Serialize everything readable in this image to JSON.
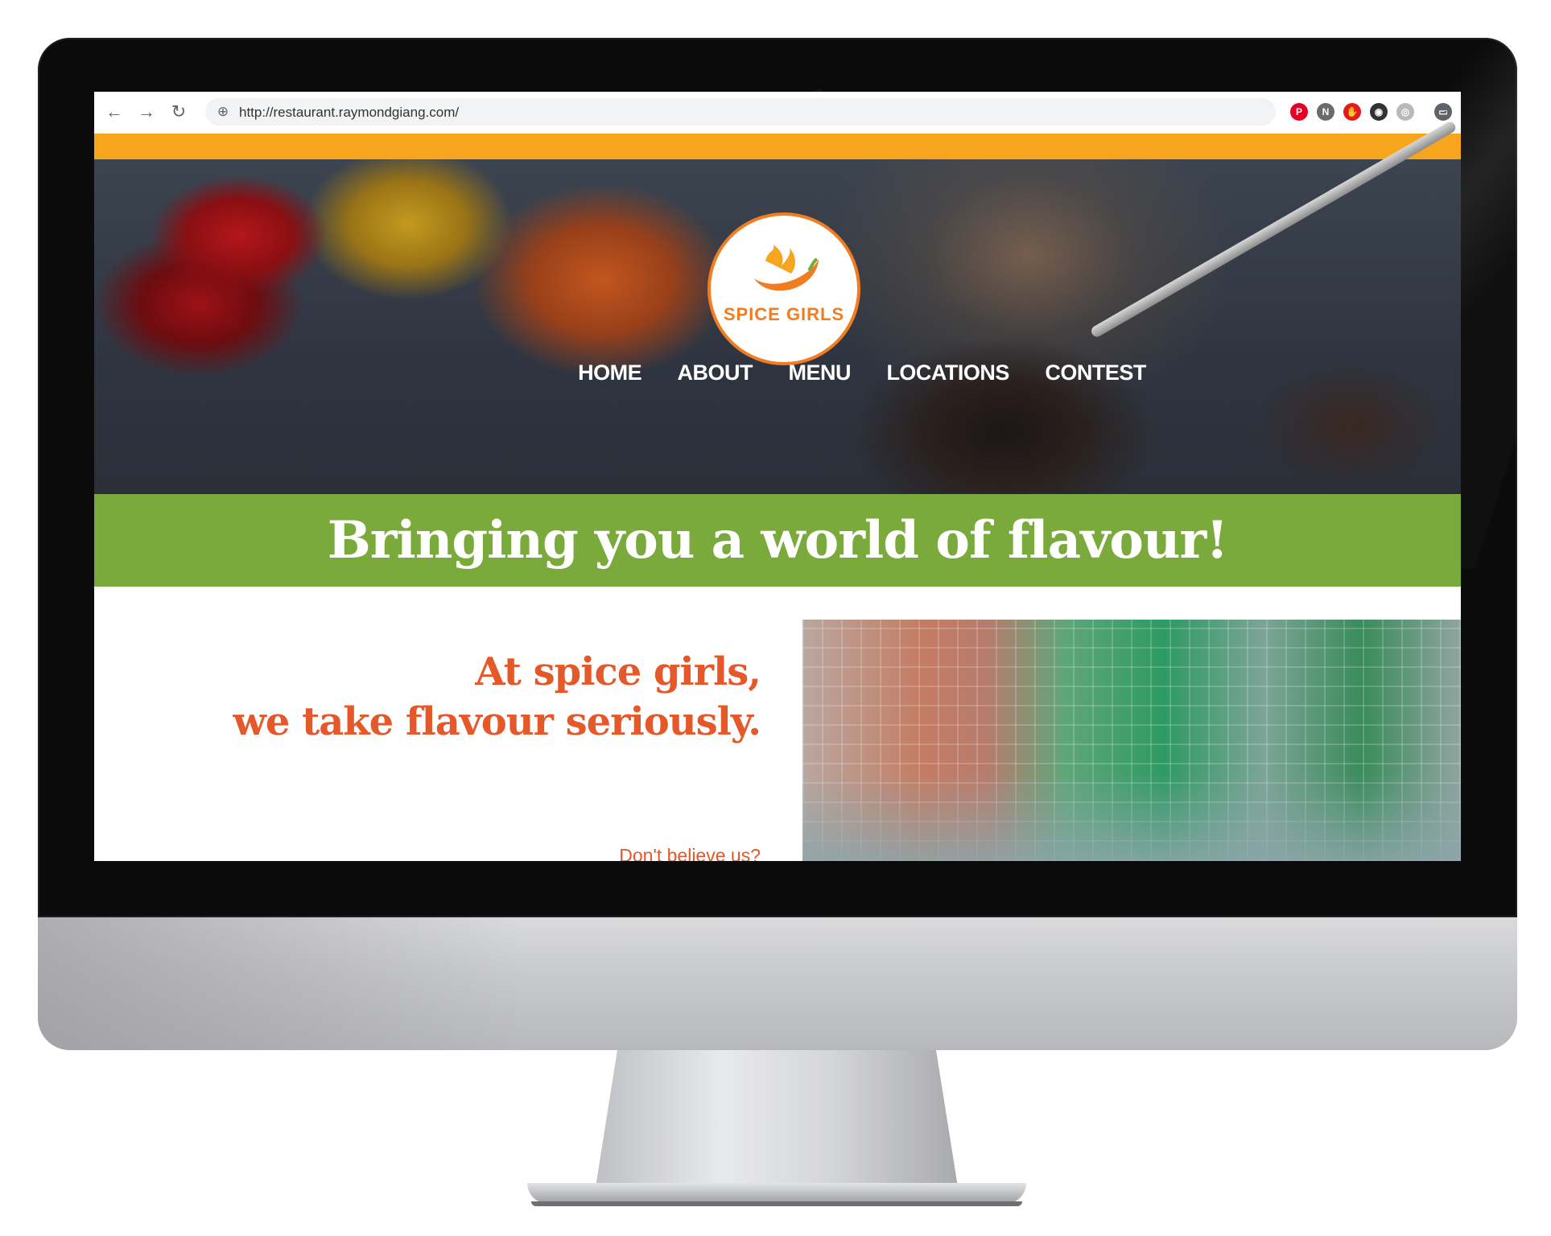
{
  "browser": {
    "url": "http://restaurant.raymondgiang.com/",
    "back_label": "←",
    "forward_label": "→",
    "reload_label": "↻",
    "menu_label": "⋮",
    "extensions": [
      {
        "icon": "pinterest-icon",
        "glyph": "P",
        "color": "#e60023"
      },
      {
        "icon": "notion-icon",
        "glyph": "N",
        "color": "#6b6b6b"
      },
      {
        "icon": "adblock-icon",
        "glyph": "✋",
        "color": "#e21b1b"
      },
      {
        "icon": "camera-icon",
        "glyph": "◉",
        "color": "#333333"
      },
      {
        "icon": "extension-icon",
        "glyph": "◎",
        "color": "#b9b9b9"
      },
      {
        "icon": "cast-icon",
        "glyph": "▭",
        "color": "#5f6368"
      },
      {
        "icon": "avatar-icon",
        "glyph": "•",
        "color": "#8a6d5a"
      }
    ]
  },
  "site": {
    "logo_text": "SPICE GIRLS",
    "nav": [
      "HOME",
      "ABOUT",
      "MENU",
      "LOCATIONS",
      "CONTEST"
    ],
    "banner": "Bringing you a world of flavour!",
    "intro_line1": "At spice girls,",
    "intro_line2": "we take flavour seriously.",
    "intro_link": "Don't believe us?"
  },
  "colors": {
    "accent_orange": "#f7a51c",
    "brand_orange": "#f07d21",
    "banner_green": "#7aa93c",
    "text_orange": "#e4582a"
  }
}
